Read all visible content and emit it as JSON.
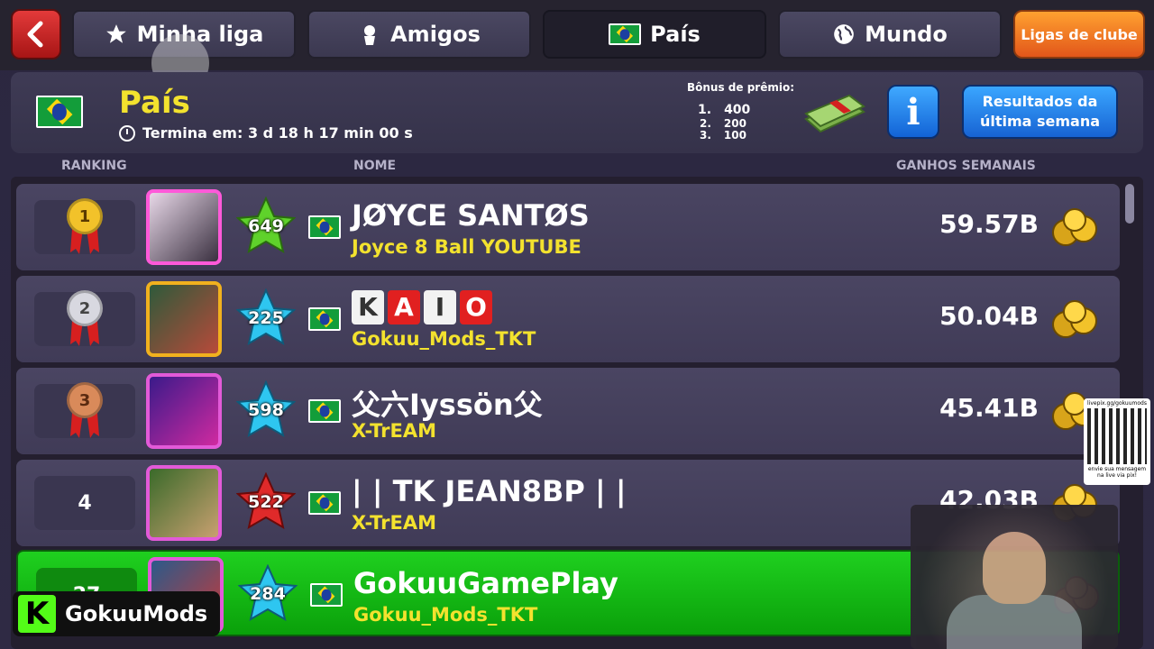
{
  "tabs": {
    "minha_liga": "Minha liga",
    "amigos": "Amigos",
    "pais": "País",
    "mundo": "Mundo",
    "club_leagues": "Ligas de clube"
  },
  "header": {
    "title": "País",
    "ends_label": "Termina em: 3 d 18 h 17 min 00 s",
    "bonus_title": "Bônus de prêmio:",
    "bonus": [
      {
        "place": "1.",
        "value": "400"
      },
      {
        "place": "2.",
        "value": "200"
      },
      {
        "place": "3.",
        "value": "100"
      }
    ],
    "info_label": "i",
    "results_button": "Resultados da última semana"
  },
  "columns": {
    "ranking": "RANKING",
    "name": "NOME",
    "earnings": "GANHOS SEMANAIS"
  },
  "rows": [
    {
      "rank": "1",
      "level": "649",
      "name": "JØYCE SANTØS",
      "club": "Joyce 8 Ball YOUTUBE",
      "earnings": "59.57B",
      "star_color": "#5fd22b"
    },
    {
      "rank": "2",
      "level": "225",
      "name": "KAIO",
      "name_letters": [
        "K",
        "A",
        "I",
        "O"
      ],
      "club": "Gokuu_Mods_TKT",
      "earnings": "50.04B",
      "star_color": "#2ec6f0"
    },
    {
      "rank": "3",
      "level": "598",
      "name": "父六Iyssön父",
      "club": "X-TrEAM",
      "earnings": "45.41B",
      "star_color": "#2ec6f0"
    },
    {
      "rank": "4",
      "level": "522",
      "name": "| | TK JEAN8BP | |",
      "club": "X-TrEAM",
      "earnings": "42.03B",
      "star_color": "#e02a2a"
    },
    {
      "rank": "27",
      "level": "284",
      "name": "GokuuGamePlay",
      "club": "Gokuu_Mods_TKT",
      "earnings": "",
      "star_color": "#2ec6f0"
    }
  ],
  "overlay": {
    "watermark": "GokuuMods",
    "qr_top": "livepix.gg/gokuumods",
    "qr_bottom": "envie sua mensagem na live via pix!"
  },
  "colors": {
    "accent_yellow": "#f3e22e",
    "highlight_green": "#15b515",
    "back_red": "#d62c2c",
    "info_blue": "#1e7ee8"
  }
}
